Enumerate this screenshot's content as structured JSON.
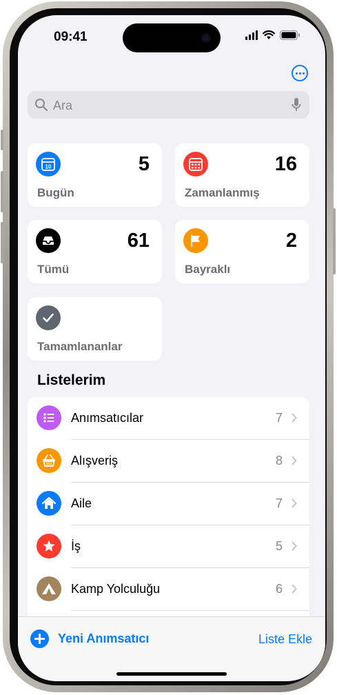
{
  "status_bar": {
    "time": "09:41"
  },
  "search": {
    "placeholder": "Ara"
  },
  "smart_lists": [
    {
      "label": "Bugün",
      "count": "5",
      "icon": "calendar-today-icon",
      "color": "#0a7aff"
    },
    {
      "label": "Zamanlanmış",
      "count": "16",
      "icon": "calendar-icon",
      "color": "#ff3b30"
    },
    {
      "label": "Tümü",
      "count": "61",
      "icon": "tray-icon",
      "color": "#000000"
    },
    {
      "label": "Bayraklı",
      "count": "2",
      "icon": "flag-icon",
      "color": "#ff9500"
    },
    {
      "label": "Tamamlananlar",
      "count": "",
      "icon": "checkmark-icon",
      "color": "#5e6770"
    }
  ],
  "calendar_icon_day": "10",
  "my_lists": {
    "title": "Listelerim",
    "items": [
      {
        "name": "Anımsatıcılar",
        "count": "7",
        "icon": "list-bullet-icon",
        "color": "#bf5af2"
      },
      {
        "name": "Alışveriş",
        "count": "8",
        "icon": "basket-icon",
        "color": "#ff9500"
      },
      {
        "name": "Aile",
        "count": "7",
        "icon": "house-icon",
        "color": "#0a7aff"
      },
      {
        "name": "İş",
        "count": "5",
        "icon": "star-icon",
        "color": "#ff3b30"
      },
      {
        "name": "Kamp Yolculuğu",
        "count": "6",
        "icon": "tent-icon",
        "color": "#a2845e"
      }
    ]
  },
  "toolbar": {
    "new_reminder": "Yeni Anımsatıcı",
    "add_list": "Liste Ekle"
  },
  "colors": {
    "accent": "#0a7aff",
    "background": "#f2f2f7"
  }
}
